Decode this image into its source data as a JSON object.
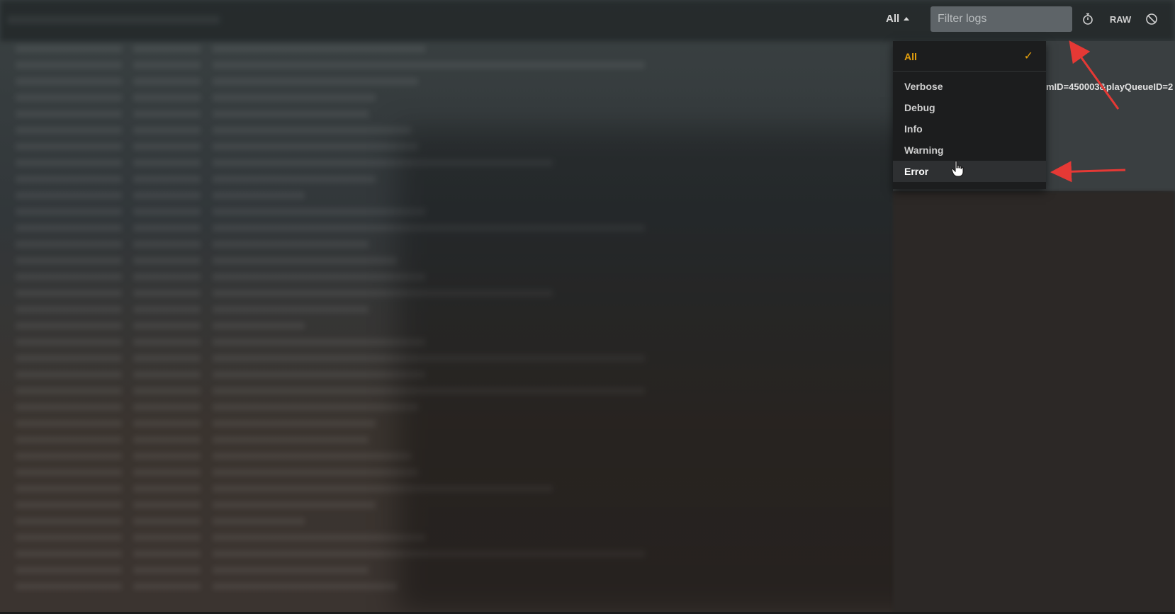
{
  "toolbar": {
    "level_label": "All",
    "filter_placeholder": "Filter logs",
    "raw_label": "RAW",
    "icons": {
      "level_caret": "caret-up-icon",
      "timer": "stopwatch-icon",
      "clear": "prohibited-icon"
    }
  },
  "dropdown": {
    "selected": "All",
    "items": [
      {
        "label": "All",
        "selected": true
      },
      {
        "label": "Verbose"
      },
      {
        "label": "Debug"
      },
      {
        "label": "Info"
      },
      {
        "label": "Warning"
      },
      {
        "label": "Error",
        "hovered": true
      }
    ],
    "check_icon": "checkmark-icon"
  },
  "log_snippet": "mID=450003&playQueueID=2",
  "annotations": {
    "arrow_color": "#e53935",
    "targets": [
      "filter-input",
      "dropdown-item-error"
    ]
  },
  "colors": {
    "accent": "#e5a00d",
    "dropdown_bg": "#1c1d1e",
    "input_bg": "#5e6468"
  }
}
